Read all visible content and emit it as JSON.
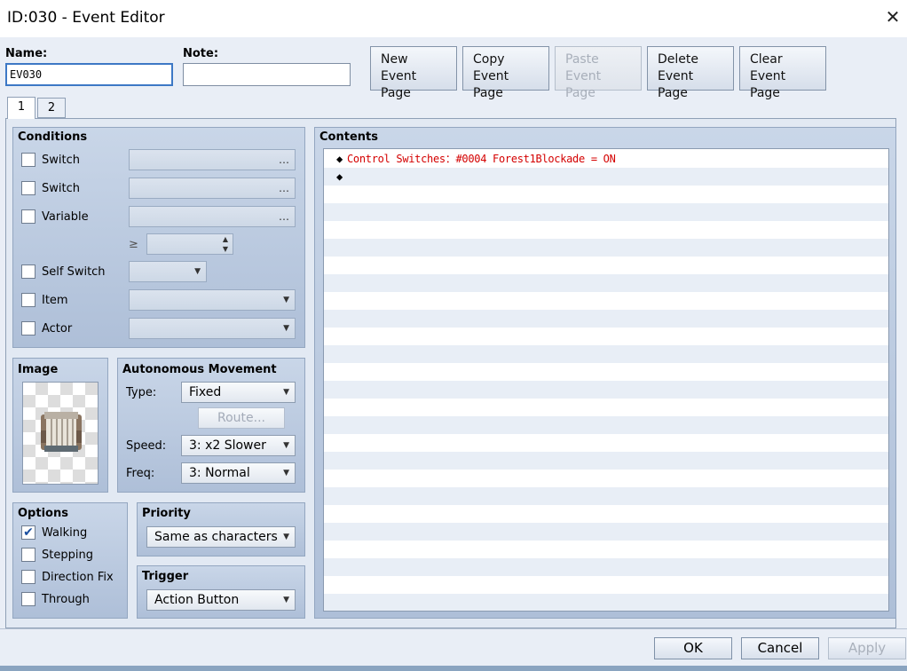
{
  "window": {
    "title": "ID:030 - Event Editor",
    "close": "✕"
  },
  "header": {
    "name_label": "Name:",
    "name_value": "EV030",
    "note_label": "Note:",
    "note_value": "",
    "buttons": [
      {
        "line1": "New",
        "line2": "Event Page",
        "enabled": true
      },
      {
        "line1": "Copy",
        "line2": "Event Page",
        "enabled": true
      },
      {
        "line1": "Paste",
        "line2": "Event Page",
        "enabled": false
      },
      {
        "line1": "Delete",
        "line2": "Event Page",
        "enabled": true
      },
      {
        "line1": "Clear",
        "line2": "Event Page",
        "enabled": true
      }
    ]
  },
  "tabs": [
    {
      "label": "1",
      "active": true
    },
    {
      "label": "2",
      "active": false
    }
  ],
  "conditions": {
    "title": "Conditions",
    "switch1": "Switch",
    "switch2": "Switch",
    "variable": "Variable",
    "gte": "≥",
    "self_switch": "Self Switch",
    "item": "Item",
    "actor": "Actor",
    "dots": "…"
  },
  "image": {
    "title": "Image",
    "icon": "barrel-cart-sprite"
  },
  "movement": {
    "title": "Autonomous Movement",
    "type_label": "Type:",
    "type_value": "Fixed",
    "route_label": "Route...",
    "speed_label": "Speed:",
    "speed_value": "3: x2 Slower",
    "freq_label": "Freq:",
    "freq_value": "3: Normal"
  },
  "options": {
    "title": "Options",
    "items": [
      {
        "label": "Walking",
        "checked": true
      },
      {
        "label": "Stepping",
        "checked": false
      },
      {
        "label": "Direction Fix",
        "checked": false
      },
      {
        "label": "Through",
        "checked": false
      }
    ]
  },
  "priority": {
    "title": "Priority",
    "value": "Same as characters"
  },
  "trigger": {
    "title": "Trigger",
    "value": "Action Button"
  },
  "contents": {
    "title": "Contents",
    "lines": [
      {
        "marker": "◆",
        "text": "Control Switches：#0004 Forest1Blockade = ON"
      },
      {
        "marker": "◆",
        "text": ""
      }
    ]
  },
  "footer": {
    "ok": "OK",
    "cancel": "Cancel",
    "apply": "Apply"
  }
}
